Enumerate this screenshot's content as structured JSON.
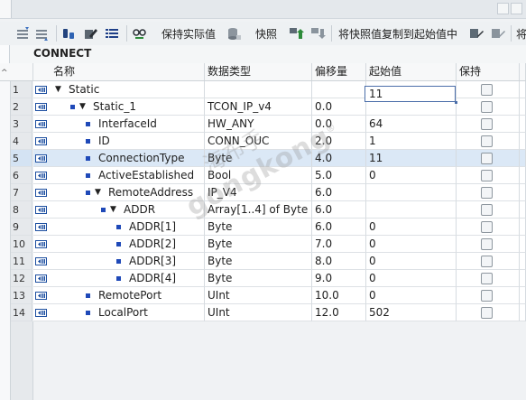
{
  "toolbar": {
    "keep_actual_label": "保持实际值",
    "snapshot_label": "快照",
    "copy_snapshot_label": "将快照值复制到起始值中",
    "overflow_label": "将"
  },
  "block": {
    "title": "CONNECT"
  },
  "columns": {
    "name": "名称",
    "type": "数据类型",
    "offset": "偏移量",
    "start": "起始值",
    "retain": "保持"
  },
  "rows": [
    {
      "n": "1",
      "name": "Static",
      "type": "",
      "offset": "",
      "start": ""
    },
    {
      "n": "2",
      "name": "Static_1",
      "type": "TCON_IP_v4",
      "offset": "0.0",
      "start": ""
    },
    {
      "n": "3",
      "name": "InterfaceId",
      "type": "HW_ANY",
      "offset": "0.0",
      "start": "64"
    },
    {
      "n": "4",
      "name": "ID",
      "type": "CONN_OUC",
      "offset": "2.0",
      "start": "1"
    },
    {
      "n": "5",
      "name": "ConnectionType",
      "type": "Byte",
      "offset": "4.0",
      "start": "11"
    },
    {
      "n": "6",
      "name": "ActiveEstablished",
      "type": "Bool",
      "offset": "5.0",
      "start": "0"
    },
    {
      "n": "7",
      "name": "RemoteAddress",
      "type": "IP_V4",
      "offset": "6.0",
      "start": ""
    },
    {
      "n": "8",
      "name": "ADDR",
      "type": "Array[1..4] of Byte",
      "offset": "6.0",
      "start": ""
    },
    {
      "n": "9",
      "name": "ADDR[1]",
      "type": "Byte",
      "offset": "6.0",
      "start": "0"
    },
    {
      "n": "10",
      "name": "ADDR[2]",
      "type": "Byte",
      "offset": "7.0",
      "start": "0"
    },
    {
      "n": "11",
      "name": "ADDR[3]",
      "type": "Byte",
      "offset": "8.0",
      "start": "0"
    },
    {
      "n": "12",
      "name": "ADDR[4]",
      "type": "Byte",
      "offset": "9.0",
      "start": "0"
    },
    {
      "n": "13",
      "name": "RemotePort",
      "type": "UInt",
      "offset": "10.0",
      "start": "0"
    },
    {
      "n": "14",
      "name": "LocalPort",
      "type": "UInt",
      "offset": "12.0",
      "start": "502"
    }
  ],
  "editing_value": "11",
  "watermark": {
    "line1": "海布手",
    "line2": "gongkong",
    "registered": "®"
  },
  "colors": {
    "interface_icon": "#1d4fa0",
    "bullet": "#1f49b8",
    "edit_border": "#4b6ea9"
  }
}
